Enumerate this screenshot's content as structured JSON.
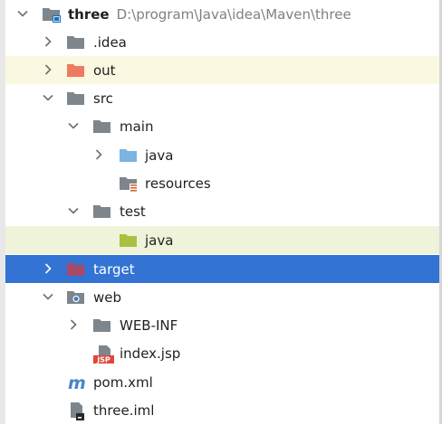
{
  "colors": {
    "folder_gray": "#7d868d",
    "folder_orange": "#ee7a60",
    "folder_blue": "#79b4e2",
    "folder_green": "#acc03f",
    "folder_maroon": "#a94968",
    "module_blue": "#1a6ec2",
    "selected_bg": "#3373d4",
    "jsp_red": "#e0463b",
    "maven_blue": "#4a86c5"
  },
  "tree": {
    "rows": [
      {
        "label": "three",
        "path": "D:\\program\\Java\\idea\\Maven\\three",
        "icon": "module-folder-icon",
        "state": "expanded"
      },
      {
        "label": ".idea",
        "icon": "folder-icon",
        "state": "collapsed"
      },
      {
        "label": "out",
        "icon": "excluded-folder-icon",
        "state": "collapsed"
      },
      {
        "label": "src",
        "icon": "folder-icon",
        "state": "expanded"
      },
      {
        "label": "main",
        "icon": "folder-icon",
        "state": "expanded"
      },
      {
        "label": "java",
        "icon": "source-root-icon",
        "state": "collapsed"
      },
      {
        "label": "resources",
        "icon": "resources-root-icon",
        "state": "leaf"
      },
      {
        "label": "test",
        "icon": "folder-icon",
        "state": "expanded"
      },
      {
        "label": "java",
        "icon": "test-root-icon",
        "state": "leaf"
      },
      {
        "label": "target",
        "icon": "target-folder-icon",
        "state": "collapsed"
      },
      {
        "label": "web",
        "icon": "web-folder-icon",
        "state": "expanded"
      },
      {
        "label": "WEB-INF",
        "icon": "folder-icon",
        "state": "collapsed"
      },
      {
        "label": "index.jsp",
        "icon": "jsp-file-icon",
        "badge": "JSP",
        "state": "leaf"
      },
      {
        "label": "pom.xml",
        "icon": "maven-file-icon",
        "badge": "m",
        "state": "leaf"
      },
      {
        "label": "three.iml",
        "icon": "iml-file-icon",
        "state": "leaf"
      }
    ]
  }
}
